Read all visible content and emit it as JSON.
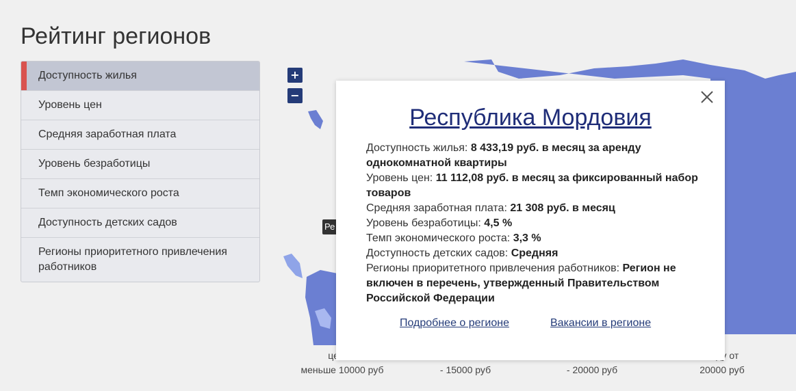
{
  "page": {
    "title": "Рейтинг регионов"
  },
  "menu": {
    "items": [
      {
        "label": "Доступность жилья",
        "active": true
      },
      {
        "label": "Уровень цен"
      },
      {
        "label": "Средняя заработная плата"
      },
      {
        "label": "Уровень безработицы"
      },
      {
        "label": "Темп экономического роста"
      },
      {
        "label": "Доступность детских садов"
      },
      {
        "label": "Регионы приоритетного привлечения работников"
      }
    ]
  },
  "map": {
    "zoom_in": "+",
    "zoom_out": "−",
    "tooltip_fragment": "Ре",
    "colors": {
      "dark": "#6b7fd2",
      "light": "#8fa4e8",
      "lighter": "#a9b8f0"
    }
  },
  "legend": {
    "items": [
      {
        "line1": "цена з",
        "line2": "меньше 10000 руб"
      },
      {
        "line1": "",
        "line2": "- 15000 руб"
      },
      {
        "line1": "",
        "line2": "- 20000 руб"
      },
      {
        "line1": "енду от",
        "line2": "20000 руб"
      }
    ]
  },
  "popup": {
    "title": "Республика Мордовия",
    "rows": [
      {
        "label": "Доступность жилья:",
        "value": "8 433,19 руб. в месяц за аренду однокомнатной квартиры"
      },
      {
        "label": "Уровень цен:",
        "value": "11 112,08 руб. в месяц за фиксированный набор товаров"
      },
      {
        "label": "Средняя заработная плата:",
        "value": "21 308 руб. в месяц"
      },
      {
        "label": "Уровень безработицы:",
        "value": "4,5 %"
      },
      {
        "label": "Темп экономического роста:",
        "value": "3,3 %"
      },
      {
        "label": "Доступность детских садов:",
        "value": "Средняя"
      },
      {
        "label": "Регионы приоритетного привлечения работников:",
        "value": "Регион не включен в перечень, утвержденный Правительством Российской Федерации"
      }
    ],
    "link_details": "Подробнее о регионе",
    "link_vacancies": "Вакансии в регионе"
  }
}
